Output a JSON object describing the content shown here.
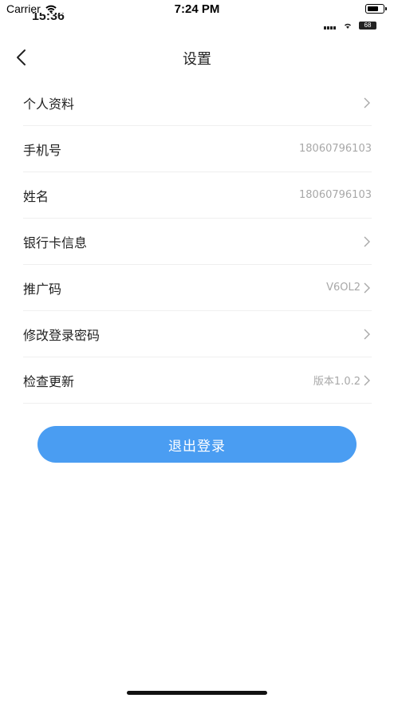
{
  "status_bar": {
    "carrier": "Carrier",
    "time": "7:24 PM",
    "ghost_time": "15:36",
    "ghost_battery": "68"
  },
  "nav": {
    "title": "设置"
  },
  "settings": [
    {
      "label": "个人资料",
      "value": "",
      "chevron": true
    },
    {
      "label": "手机号",
      "value": "18060796103",
      "chevron": false
    },
    {
      "label": "姓名",
      "value": "18060796103",
      "chevron": false
    },
    {
      "label": "银行卡信息",
      "value": "",
      "chevron": true
    },
    {
      "label": "推广码",
      "value": "V6OL2",
      "chevron": true
    },
    {
      "label": "修改登录密码",
      "value": "",
      "chevron": true
    },
    {
      "label": "检查更新",
      "value": "版本1.0.2",
      "chevron": true
    }
  ],
  "logout": {
    "label": "退出登录"
  },
  "colors": {
    "accent": "#4a9df2",
    "divider": "#efefef",
    "value_text": "#a8a8a8"
  }
}
